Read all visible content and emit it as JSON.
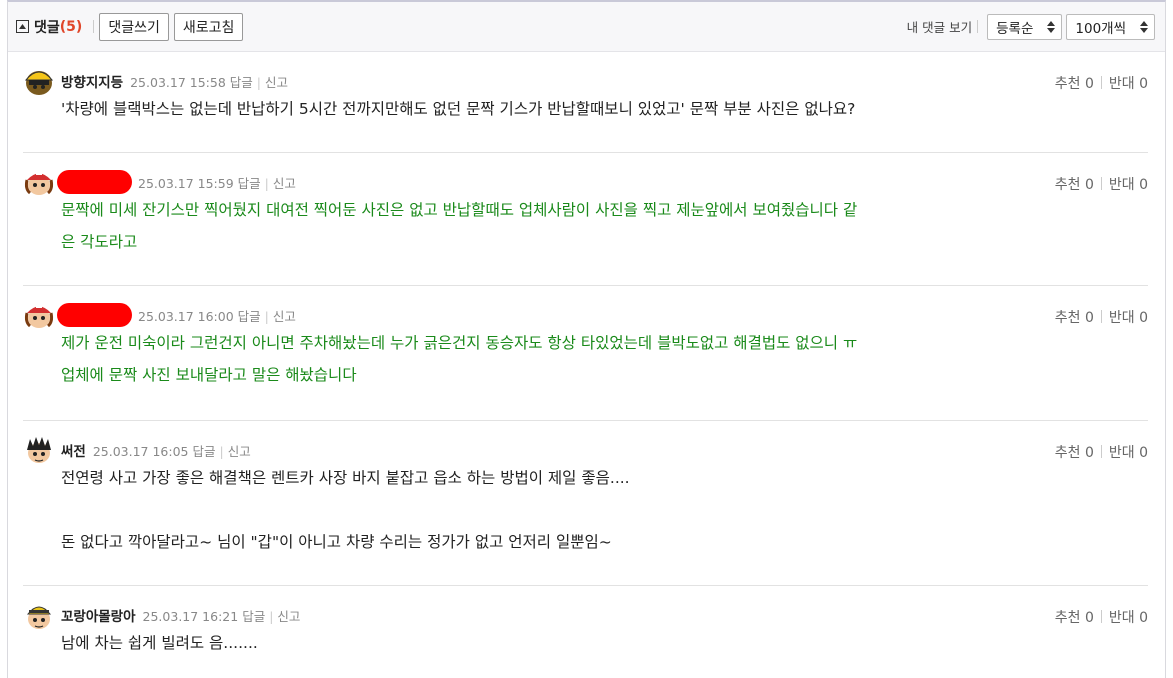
{
  "toolbar": {
    "title": "댓글",
    "count": "(5)",
    "write_label": "댓글쓰기",
    "refresh_label": "새로고침",
    "my_comments_label": "내 댓글 보기",
    "sort_selected": "등록순",
    "per_page_selected": "100개씩"
  },
  "comments": [
    {
      "nick": "방향지지등",
      "date": "25.03.17 15:58",
      "reply": "답글",
      "report": "신고",
      "up": "추천 0",
      "down": "반대 0",
      "lines": [
        "'차량에 블랙박스는 없는데 반납하기 5시간 전까지만해도 없던 문짝 기스가 반납할때보니 있었고' 문짝 부분 사진은 없나요?"
      ]
    },
    {
      "nick": "",
      "date": "25.03.17 15:59",
      "reply": "답글",
      "report": "신고",
      "up": "추천 0",
      "down": "반대 0",
      "lines": [
        "문짝에 미세 잔기스만 찍어뒀지 대여전 찍어둔 사진은 없고 반납할때도 업체사람이 사진을 찍고 제눈앞에서 보여줬습니다 같",
        "은 각도라고"
      ]
    },
    {
      "nick": "",
      "date": "25.03.17 16:00",
      "reply": "답글",
      "report": "신고",
      "up": "추천 0",
      "down": "반대 0",
      "lines": [
        "제가 운전 미숙이라 그런건지 아니면 주차해놨는데 누가 긁은건지 동승자도 항상 타있었는데 블박도없고 해결법도 없으니 ㅠ",
        "업체에 문짝 사진 보내달라고 말은 해놨습니다"
      ]
    },
    {
      "nick": "써전",
      "date": "25.03.17 16:05",
      "reply": "답글",
      "report": "신고",
      "up": "추천 0",
      "down": "반대 0",
      "lines": [
        "전연령 사고 가장 좋은 해결책은 렌트카 사장 바지 붙잡고 읍소 하는 방법이 제일 좋음....",
        "",
        "돈 없다고 깍아달라고~ 님이 \"갑\"이 아니고 차량 수리는 정가가 없고 언저리 일뿐임~"
      ]
    },
    {
      "nick": "꼬랑아몰랑아",
      "date": "25.03.17 16:21",
      "reply": "답글",
      "report": "신고",
      "up": "추천 0",
      "down": "반대 0",
      "lines": [
        "남에 차는 쉽게 빌려도 음......."
      ]
    }
  ],
  "colors": {
    "accent_count": "#e0462a",
    "author_reply_text": "#1a8a1a",
    "redaction": "#ff0000"
  },
  "icons": [
    "collapse-icon",
    "sort-arrows-icon",
    "avatar-icon"
  ]
}
